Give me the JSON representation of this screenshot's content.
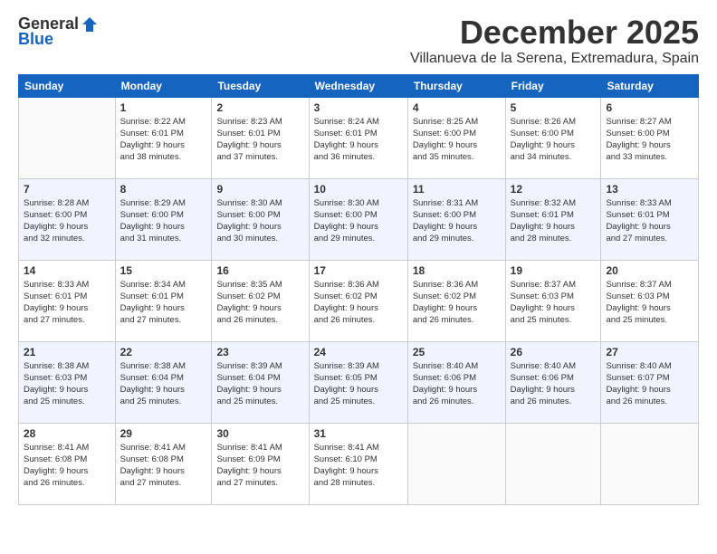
{
  "logo": {
    "general": "General",
    "blue": "Blue"
  },
  "title": "December 2025",
  "location": "Villanueva de la Serena, Extremadura, Spain",
  "days_header": [
    "Sunday",
    "Monday",
    "Tuesday",
    "Wednesday",
    "Thursday",
    "Friday",
    "Saturday"
  ],
  "weeks": [
    [
      {
        "day": "",
        "info": ""
      },
      {
        "day": "1",
        "info": "Sunrise: 8:22 AM\nSunset: 6:01 PM\nDaylight: 9 hours\nand 38 minutes."
      },
      {
        "day": "2",
        "info": "Sunrise: 8:23 AM\nSunset: 6:01 PM\nDaylight: 9 hours\nand 37 minutes."
      },
      {
        "day": "3",
        "info": "Sunrise: 8:24 AM\nSunset: 6:01 PM\nDaylight: 9 hours\nand 36 minutes."
      },
      {
        "day": "4",
        "info": "Sunrise: 8:25 AM\nSunset: 6:00 PM\nDaylight: 9 hours\nand 35 minutes."
      },
      {
        "day": "5",
        "info": "Sunrise: 8:26 AM\nSunset: 6:00 PM\nDaylight: 9 hours\nand 34 minutes."
      },
      {
        "day": "6",
        "info": "Sunrise: 8:27 AM\nSunset: 6:00 PM\nDaylight: 9 hours\nand 33 minutes."
      }
    ],
    [
      {
        "day": "7",
        "info": "Sunrise: 8:28 AM\nSunset: 6:00 PM\nDaylight: 9 hours\nand 32 minutes."
      },
      {
        "day": "8",
        "info": "Sunrise: 8:29 AM\nSunset: 6:00 PM\nDaylight: 9 hours\nand 31 minutes."
      },
      {
        "day": "9",
        "info": "Sunrise: 8:30 AM\nSunset: 6:00 PM\nDaylight: 9 hours\nand 30 minutes."
      },
      {
        "day": "10",
        "info": "Sunrise: 8:30 AM\nSunset: 6:00 PM\nDaylight: 9 hours\nand 29 minutes."
      },
      {
        "day": "11",
        "info": "Sunrise: 8:31 AM\nSunset: 6:00 PM\nDaylight: 9 hours\nand 29 minutes."
      },
      {
        "day": "12",
        "info": "Sunrise: 8:32 AM\nSunset: 6:01 PM\nDaylight: 9 hours\nand 28 minutes."
      },
      {
        "day": "13",
        "info": "Sunrise: 8:33 AM\nSunset: 6:01 PM\nDaylight: 9 hours\nand 27 minutes."
      }
    ],
    [
      {
        "day": "14",
        "info": "Sunrise: 8:33 AM\nSunset: 6:01 PM\nDaylight: 9 hours\nand 27 minutes."
      },
      {
        "day": "15",
        "info": "Sunrise: 8:34 AM\nSunset: 6:01 PM\nDaylight: 9 hours\nand 27 minutes."
      },
      {
        "day": "16",
        "info": "Sunrise: 8:35 AM\nSunset: 6:02 PM\nDaylight: 9 hours\nand 26 minutes."
      },
      {
        "day": "17",
        "info": "Sunrise: 8:36 AM\nSunset: 6:02 PM\nDaylight: 9 hours\nand 26 minutes."
      },
      {
        "day": "18",
        "info": "Sunrise: 8:36 AM\nSunset: 6:02 PM\nDaylight: 9 hours\nand 26 minutes."
      },
      {
        "day": "19",
        "info": "Sunrise: 8:37 AM\nSunset: 6:03 PM\nDaylight: 9 hours\nand 25 minutes."
      },
      {
        "day": "20",
        "info": "Sunrise: 8:37 AM\nSunset: 6:03 PM\nDaylight: 9 hours\nand 25 minutes."
      }
    ],
    [
      {
        "day": "21",
        "info": "Sunrise: 8:38 AM\nSunset: 6:03 PM\nDaylight: 9 hours\nand 25 minutes."
      },
      {
        "day": "22",
        "info": "Sunrise: 8:38 AM\nSunset: 6:04 PM\nDaylight: 9 hours\nand 25 minutes."
      },
      {
        "day": "23",
        "info": "Sunrise: 8:39 AM\nSunset: 6:04 PM\nDaylight: 9 hours\nand 25 minutes."
      },
      {
        "day": "24",
        "info": "Sunrise: 8:39 AM\nSunset: 6:05 PM\nDaylight: 9 hours\nand 25 minutes."
      },
      {
        "day": "25",
        "info": "Sunrise: 8:40 AM\nSunset: 6:06 PM\nDaylight: 9 hours\nand 26 minutes."
      },
      {
        "day": "26",
        "info": "Sunrise: 8:40 AM\nSunset: 6:06 PM\nDaylight: 9 hours\nand 26 minutes."
      },
      {
        "day": "27",
        "info": "Sunrise: 8:40 AM\nSunset: 6:07 PM\nDaylight: 9 hours\nand 26 minutes."
      }
    ],
    [
      {
        "day": "28",
        "info": "Sunrise: 8:41 AM\nSunset: 6:08 PM\nDaylight: 9 hours\nand 26 minutes."
      },
      {
        "day": "29",
        "info": "Sunrise: 8:41 AM\nSunset: 6:08 PM\nDaylight: 9 hours\nand 27 minutes."
      },
      {
        "day": "30",
        "info": "Sunrise: 8:41 AM\nSunset: 6:09 PM\nDaylight: 9 hours\nand 27 minutes."
      },
      {
        "day": "31",
        "info": "Sunrise: 8:41 AM\nSunset: 6:10 PM\nDaylight: 9 hours\nand 28 minutes."
      },
      {
        "day": "",
        "info": ""
      },
      {
        "day": "",
        "info": ""
      },
      {
        "day": "",
        "info": ""
      }
    ]
  ]
}
